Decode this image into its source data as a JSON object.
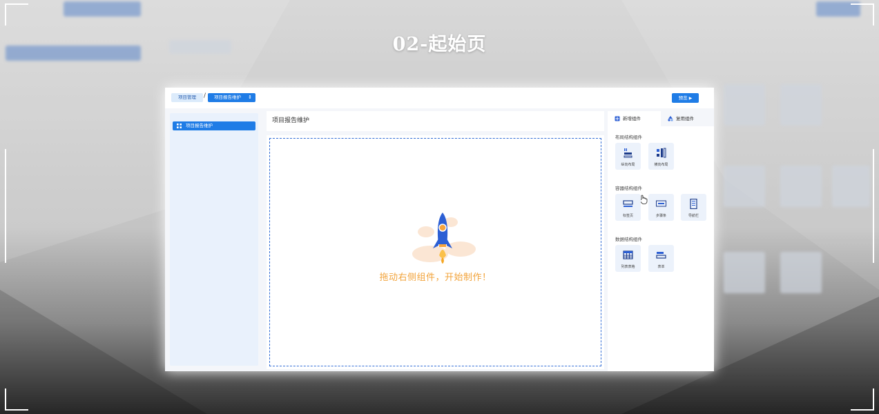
{
  "slide_title": "02-起始页",
  "breadcrumb": {
    "item1": "项目管理",
    "separator": "/",
    "item2": "项目报告维护",
    "item2_icon": "updown-arrows-icon"
  },
  "toolbar": {
    "preview_label": "预览"
  },
  "sidebar": {
    "items": [
      {
        "label": "项目报告维护",
        "icon": "grid-icon"
      }
    ]
  },
  "main": {
    "header_title": "项目报告维护",
    "empty_hint": "拖动右侧组件，开始制作！"
  },
  "right_panel": {
    "tabs": [
      {
        "label": "新增组件",
        "icon": "plus-square-icon",
        "active": true
      },
      {
        "label": "复用组件",
        "icon": "shapes-icon",
        "active": false
      }
    ],
    "sections": [
      {
        "title": "布局结构组件",
        "components": [
          {
            "label": "纵向布局",
            "icon": "vertical-layout-icon"
          },
          {
            "label": "横向布局",
            "icon": "horizontal-layout-icon"
          }
        ]
      },
      {
        "title": "容器结构组件",
        "components": [
          {
            "label": "标签页",
            "icon": "tab-page-icon"
          },
          {
            "label": "步骤条",
            "icon": "steps-bar-icon"
          },
          {
            "label": "导航栏",
            "icon": "nav-bar-icon"
          }
        ]
      },
      {
        "title": "数据结构组件",
        "components": [
          {
            "label": "列表表格",
            "icon": "table-icon"
          },
          {
            "label": "表单",
            "icon": "form-icon"
          }
        ]
      }
    ]
  },
  "colors": {
    "accent": "#1f7ce6",
    "hint_orange": "#f2a33a",
    "panel_bg": "#e9f1fc"
  }
}
